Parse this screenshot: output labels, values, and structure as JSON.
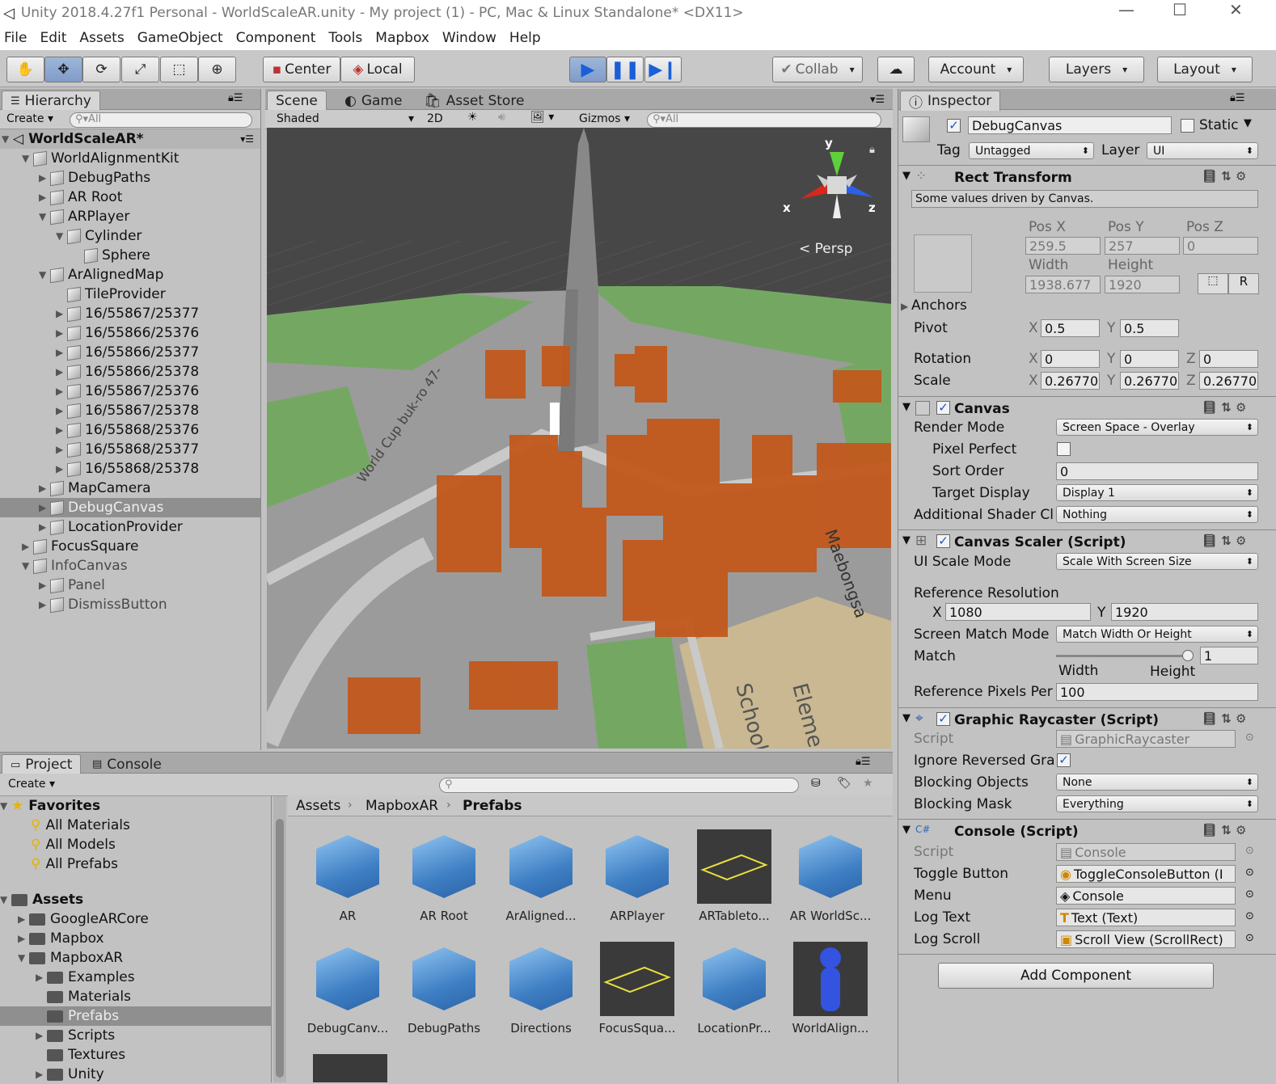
{
  "window": {
    "title": "Unity 2018.4.27f1 Personal - WorldScaleAR.unity - My project (1) - PC, Mac & Linux Standalone* <DX11>"
  },
  "menu": [
    "File",
    "Edit",
    "Assets",
    "GameObject",
    "Component",
    "Tools",
    "Mapbox",
    "Window",
    "Help"
  ],
  "toolbar": {
    "center": "Center",
    "local": "Local",
    "collab": "Collab",
    "account": "Account",
    "layers": "Layers",
    "layout": "Layout"
  },
  "hierarchy": {
    "tab": "Hierarchy",
    "create": "Create",
    "search": "All",
    "scene": "WorldScaleAR*",
    "items": [
      "WorldAlignmentKit",
      "DebugPaths",
      "AR Root",
      "ARPlayer",
      "Cylinder",
      "Sphere",
      "ArAlignedMap",
      "TileProvider",
      "16/55867/25377",
      "16/55866/25376",
      "16/55866/25377",
      "16/55866/25378",
      "16/55867/25376",
      "16/55867/25378",
      "16/55868/25376",
      "16/55868/25377",
      "16/55868/25378",
      "MapCamera",
      "DebugCanvas",
      "LocationProvider",
      "FocusSquare",
      "InfoCanvas",
      "Panel",
      "DismissButton"
    ]
  },
  "scene": {
    "tabs": [
      "Scene",
      "Game",
      "Asset Store"
    ],
    "shading": "Shaded",
    "mode2d": "2D",
    "gizmos": "Gizmos",
    "search": "All",
    "persp": "Persp",
    "axis": {
      "x": "x",
      "y": "y",
      "z": "z"
    },
    "labels": [
      "World Cup buk-ro 47-",
      "Maebongsa",
      "School",
      "Eleme"
    ]
  },
  "inspector": {
    "tab": "Inspector",
    "name": "DebugCanvas",
    "static": "Static",
    "tag_label": "Tag",
    "tag": "Untagged",
    "layer_label": "Layer",
    "layer": "UI",
    "rect": {
      "title": "Rect Transform",
      "note": "Some values driven by Canvas.",
      "posx_l": "Pos X",
      "posy_l": "Pos Y",
      "posz_l": "Pos Z",
      "posx": "259.5",
      "posy": "257",
      "posz": "0",
      "width_l": "Width",
      "height_l": "Height",
      "width": "1938.677",
      "height": "1920",
      "r": "R",
      "anchors": "Anchors",
      "pivot": "Pivot",
      "pivot_x": "0.5",
      "pivot_y": "0.5",
      "rotation": "Rotation",
      "rot_x": "0",
      "rot_y": "0",
      "rot_z": "0",
      "scale": "Scale",
      "scale_x": "0.26770",
      "scale_y": "0.26770",
      "scale_z": "0.26770",
      "x": "X",
      "y": "Y",
      "z": "Z"
    },
    "canvas": {
      "title": "Canvas",
      "render_mode_l": "Render Mode",
      "render_mode": "Screen Space - Overlay",
      "pixel_perfect_l": "Pixel Perfect",
      "sort_order_l": "Sort Order",
      "sort_order": "0",
      "target_display_l": "Target Display",
      "target_display": "Display 1",
      "shader_l": "Additional Shader Cl",
      "shader": "Nothing"
    },
    "scaler": {
      "title": "Canvas Scaler (Script)",
      "ui_scale_l": "UI Scale Mode",
      "ui_scale": "Scale With Screen Size",
      "ref_res_l": "Reference Resolution",
      "ref_x": "1080",
      "ref_y": "1920",
      "match_mode_l": "Screen Match Mode",
      "match_mode": "Match Width Or Height",
      "match_l": "Match",
      "match": "1",
      "width": "Width",
      "height": "Height",
      "ppu_l": "Reference Pixels Per",
      "ppu": "100"
    },
    "raycaster": {
      "title": "Graphic Raycaster (Script)",
      "script_l": "Script",
      "script": "GraphicRaycaster",
      "ignore_l": "Ignore Reversed Gra",
      "blocking_obj_l": "Blocking Objects",
      "blocking_obj": "None",
      "blocking_mask_l": "Blocking Mask",
      "blocking_mask": "Everything"
    },
    "console": {
      "title": "Console (Script)",
      "script_l": "Script",
      "script": "Console",
      "toggle_l": "Toggle Button",
      "toggle": "ToggleConsoleButton (I",
      "menu_l": "Menu",
      "menu": "Console",
      "logtext_l": "Log Text",
      "logtext": "Text (Text)",
      "logscroll_l": "Log Scroll",
      "logscroll": "Scroll View (ScrollRect)"
    },
    "add_component": "Add Component"
  },
  "project": {
    "tabs": [
      "Project",
      "Console"
    ],
    "create": "Create",
    "favorites": "Favorites",
    "fav_items": [
      "All Materials",
      "All Models",
      "All Prefabs"
    ],
    "assets": "Assets",
    "folders": [
      "GoogleARCore",
      "Mapbox",
      "MapboxAR",
      "Examples",
      "Materials",
      "Prefabs",
      "Scripts",
      "Textures",
      "Unity"
    ],
    "breadcrumb": [
      "Assets",
      "MapboxAR",
      "Prefabs"
    ],
    "grid": [
      "AR",
      "AR Root",
      "ArAligned...",
      "ARPlayer",
      "ARTableto...",
      "AR WorldSc...",
      "DebugCanv...",
      "DebugPaths",
      "Directions",
      "FocusSqua...",
      "LocationPr...",
      "WorldAlign..."
    ]
  }
}
